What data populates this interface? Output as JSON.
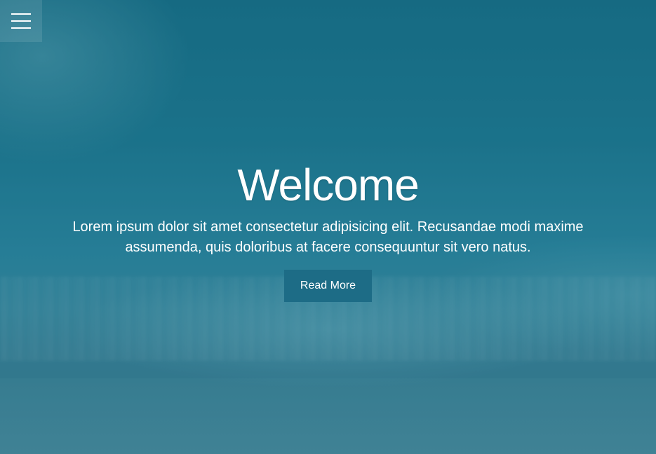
{
  "nav": {
    "menu_icon": "hamburger-menu-icon"
  },
  "hero": {
    "title": "Welcome",
    "subtitle": "Lorem ipsum dolor sit amet consectetur adipisicing elit. Recusandae modi maxime assumenda, quis doloribus at facere consequuntur sit vero natus.",
    "button_label": "Read More"
  },
  "colors": {
    "sea": "#1f6f86",
    "button": "#1d6c86",
    "text": "#ffffff"
  }
}
